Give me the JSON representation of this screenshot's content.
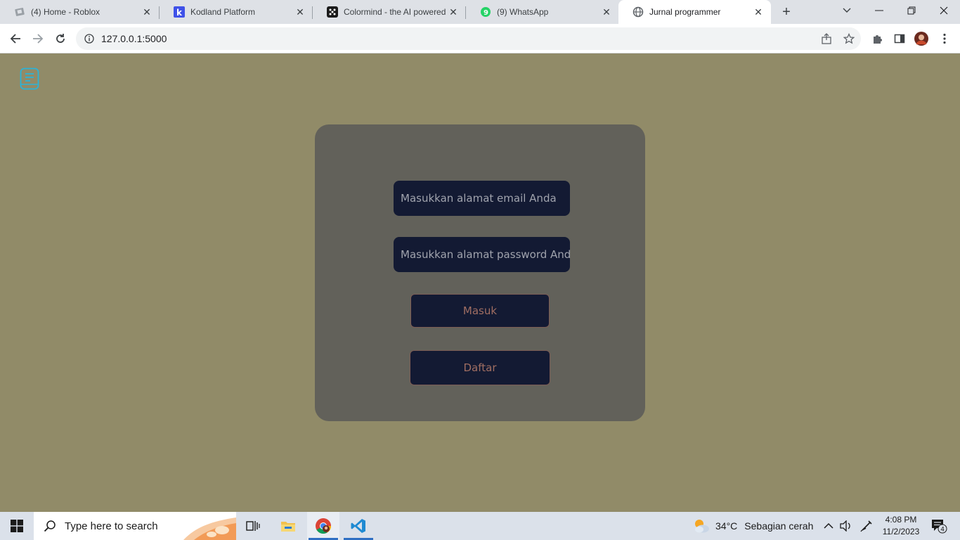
{
  "browser": {
    "tabs": [
      {
        "title": "(4) Home - Roblox",
        "icon": "roblox-icon"
      },
      {
        "title": "Kodland Platform",
        "icon": "kodland-icon"
      },
      {
        "title": "Colormind - the AI powered",
        "icon": "colormind-icon"
      },
      {
        "title": "(9) WhatsApp",
        "icon": "whatsapp-icon"
      },
      {
        "title": "Jurnal programmer",
        "icon": "globe-icon",
        "active": true
      }
    ],
    "url": "127.0.0.1:5000"
  },
  "login": {
    "email_placeholder": "Masukkan alamat email Anda",
    "password_placeholder": "Masukkan alamat password Anda",
    "login_label": "Masuk",
    "register_label": "Daftar"
  },
  "taskbar": {
    "search_placeholder": "Type here to search",
    "weather_temp": "34°C",
    "weather_desc": "Sebagian cerah",
    "time": "4:08 PM",
    "date": "11/2/2023",
    "notification_count": "4"
  },
  "colors": {
    "page_bg": "#918b68",
    "card_bg": "#62615a",
    "input_bg": "#131a33",
    "button_text": "#a06e62",
    "logo_accent": "#2bb3d8"
  }
}
